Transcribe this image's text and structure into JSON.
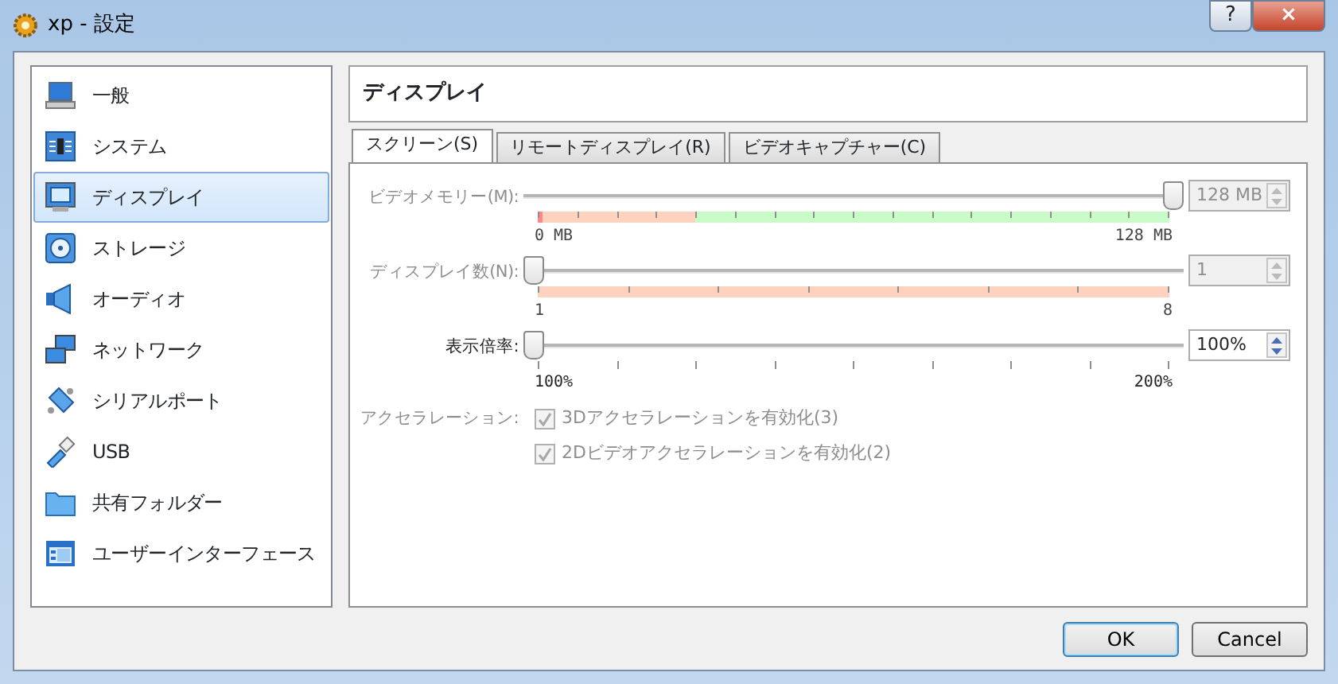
{
  "window": {
    "title": "xp - 設定",
    "buttons": [
      "?",
      "×"
    ]
  },
  "sidebar": {
    "items": [
      {
        "label": "一般",
        "kind": "laptop",
        "selected": false
      },
      {
        "label": "システム",
        "kind": "chip",
        "selected": false
      },
      {
        "label": "ディスプレイ",
        "kind": "monitor",
        "selected": true
      },
      {
        "label": "ストレージ",
        "kind": "disk",
        "selected": false
      },
      {
        "label": "オーディオ",
        "kind": "speaker",
        "selected": false
      },
      {
        "label": "ネットワーク",
        "kind": "network",
        "selected": false
      },
      {
        "label": "シリアルポート",
        "kind": "serial",
        "selected": false
      },
      {
        "label": "USB",
        "kind": "usb",
        "selected": false
      },
      {
        "label": "共有フォルダー",
        "kind": "folder",
        "selected": false
      },
      {
        "label": "ユーザーインターフェース",
        "kind": "window",
        "selected": false
      }
    ]
  },
  "page_title": "ディスプレイ",
  "tabs": [
    {
      "label": "スクリーン(S)",
      "selected": true
    },
    {
      "label": "リモートディスプレイ(R)",
      "selected": false
    },
    {
      "label": "ビデオキャプチャー(C)",
      "selected": false
    }
  ],
  "sliders": [
    {
      "label": "ビデオメモリー(M):",
      "disabled": true,
      "level": 1,
      "kind": "memory",
      "min_label": "0 MB",
      "max_label": "128 MB",
      "value": "128 MB"
    },
    {
      "label": "ディスプレイ数(N):",
      "disabled": true,
      "level": 0,
      "kind": "count",
      "min_label": "1",
      "max_label": "8",
      "value": "1"
    },
    {
      "label": "表示倍率:",
      "disabled": false,
      "level": 0,
      "kind": "scale",
      "min_label": "100%",
      "max_label": "200%",
      "value": "100%"
    }
  ],
  "acceleration": {
    "label": "アクセラレーション:",
    "disabled": true,
    "options": [
      {
        "label": "3Dアクセラレーションを有効化(3)",
        "checked": true
      },
      {
        "label": "2Dビデオアクセラレーションを有効化(2)",
        "checked": true
      }
    ]
  },
  "footer_buttons": [
    {
      "label": "OK",
      "kind": "default"
    },
    {
      "label": "Cancel",
      "kind": "normal"
    }
  ]
}
